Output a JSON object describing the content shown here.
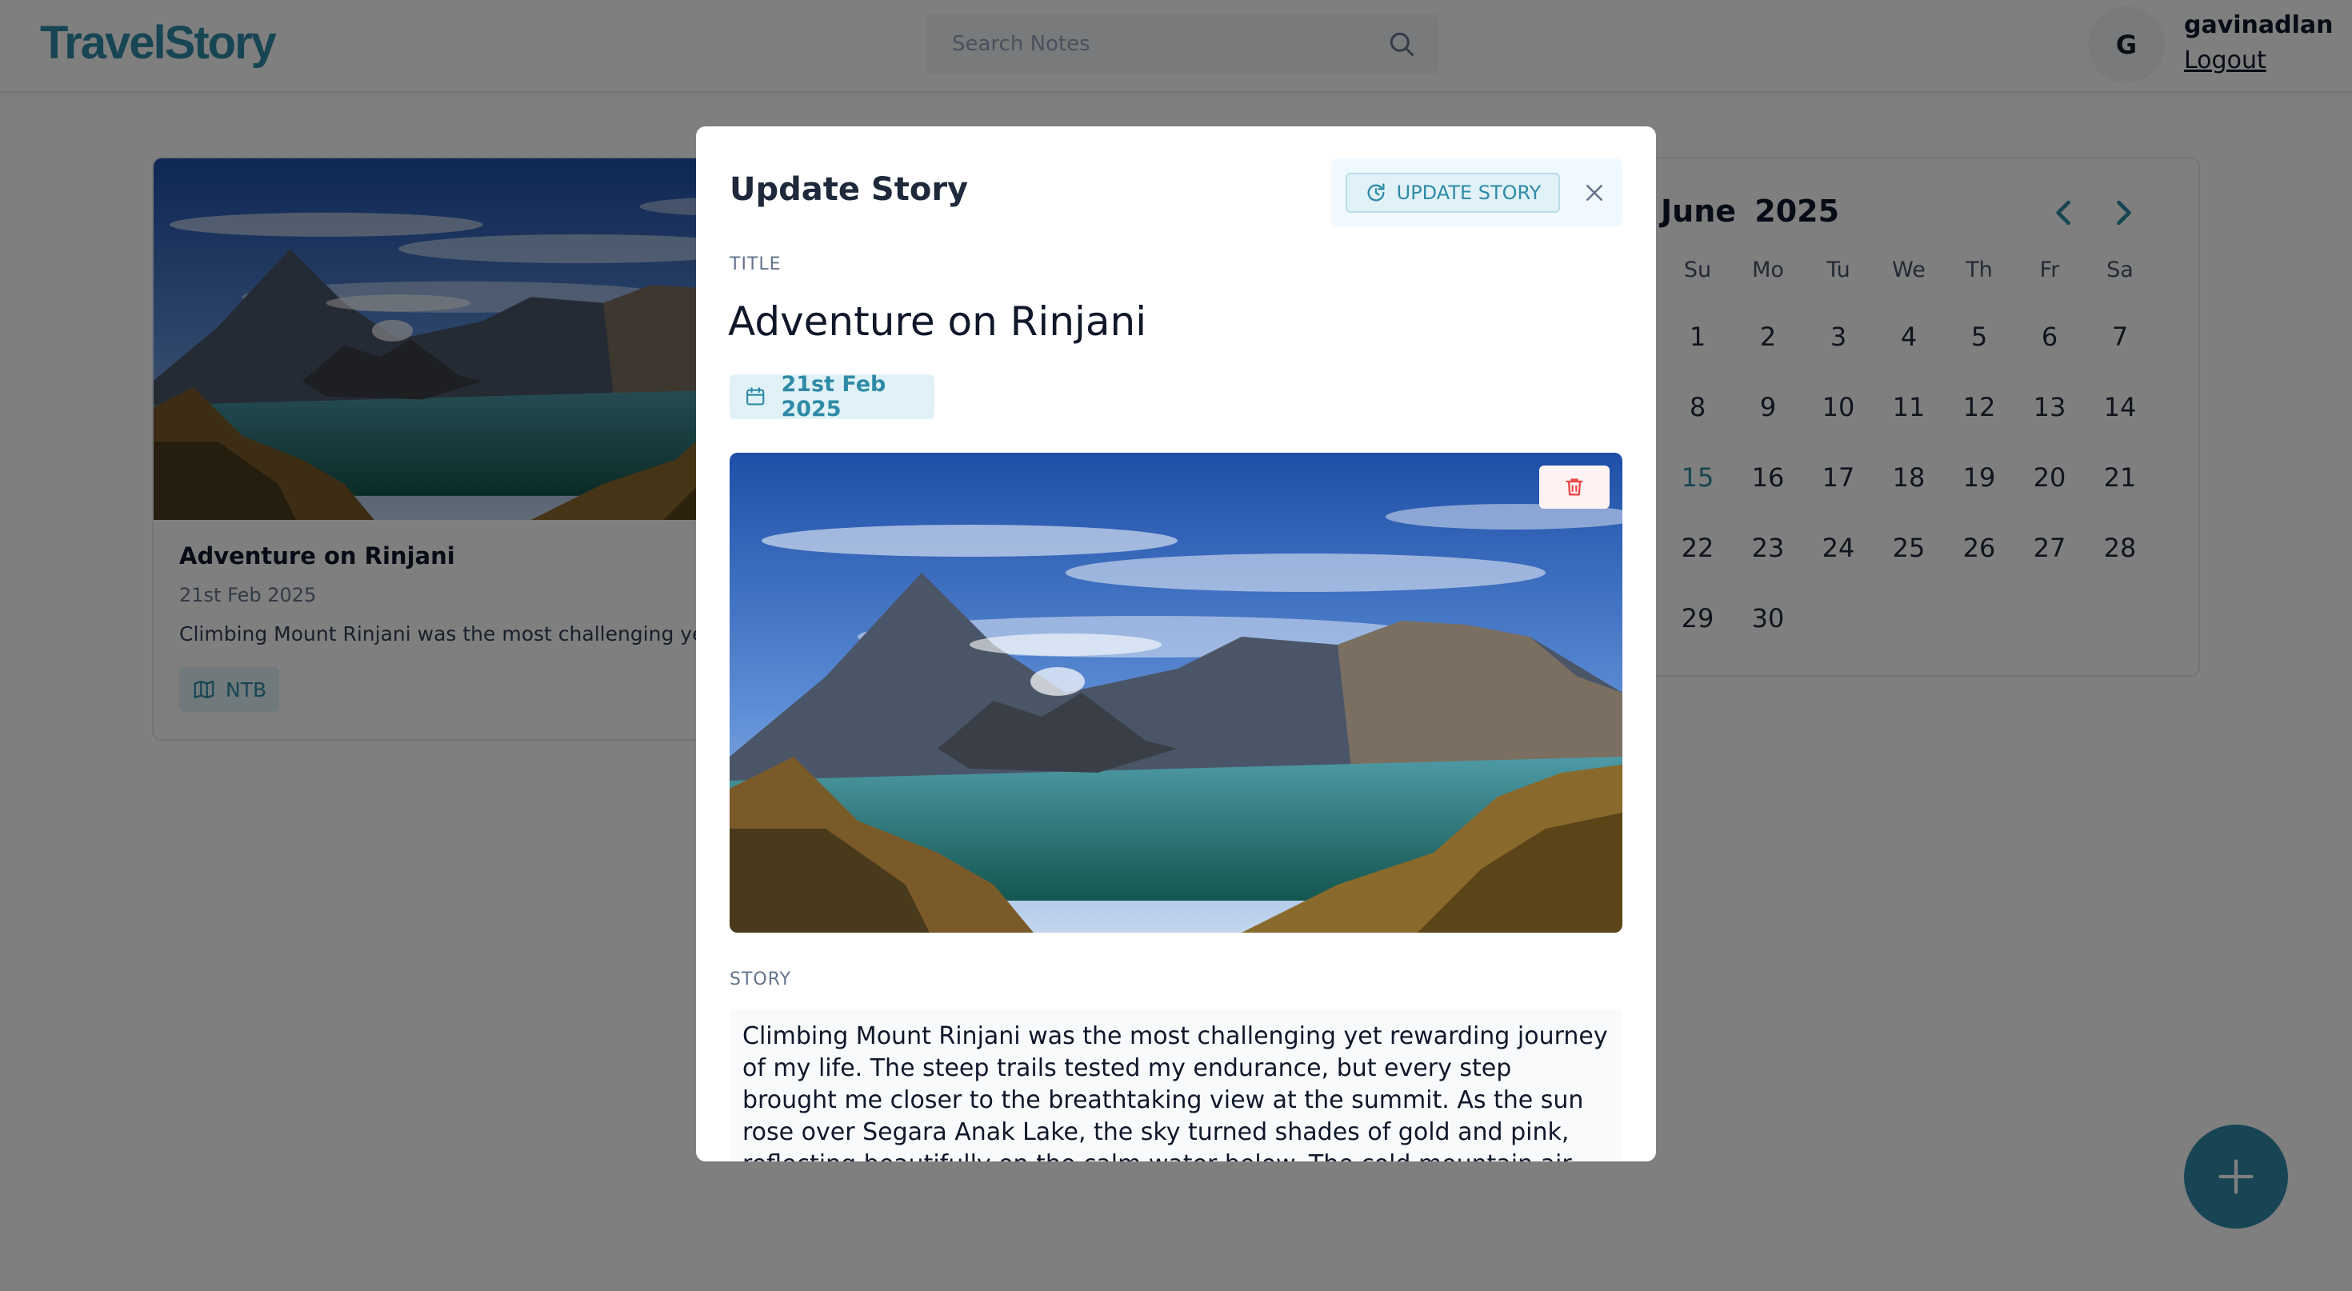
{
  "navbar": {
    "logo": "TravelStory",
    "search_placeholder": "Search Notes",
    "user_initial": "G",
    "user_name": "gavinadlan",
    "logout_label": "Logout"
  },
  "story_card": {
    "title": "Adventure on Rinjani",
    "date": "21st Feb 2025",
    "excerpt": "Climbing Mount Rinjani was the most challenging yet r",
    "location": "NTB"
  },
  "calendar": {
    "month": "June",
    "year": "2025",
    "weekdays": [
      "Su",
      "Mo",
      "Tu",
      "We",
      "Th",
      "Fr",
      "Sa"
    ],
    "days": [
      "1",
      "2",
      "3",
      "4",
      "5",
      "6",
      "7",
      "8",
      "9",
      "10",
      "11",
      "12",
      "13",
      "14",
      "15",
      "16",
      "17",
      "18",
      "19",
      "20",
      "21",
      "22",
      "23",
      "24",
      "25",
      "26",
      "27",
      "28",
      "29",
      "30"
    ],
    "today": "15"
  },
  "modal": {
    "heading": "Update Story",
    "update_label": "UPDATE STORY",
    "title_label": "TITLE",
    "title_value": "Adventure on Rinjani",
    "date": "21st Feb 2025",
    "story_label": "STORY",
    "story_text": "Climbing Mount Rinjani was the most challenging yet rewarding journey of my life. The steep trails tested my endurance, but every step brought me closer to the breathtaking view at the summit. As the sun rose over Segara Anak Lake, the sky turned shades of gold and pink, reflecting beautifully on the calm water below. The cold mountain air, the sound of the wind, and the"
  },
  "colors": {
    "brand": "#2f8aa6",
    "danger": "#ef4444",
    "overlay": "rgba(0,0,0,0.5)"
  },
  "icons": {
    "search": "search-icon",
    "calendar": "calendar-icon",
    "update": "refresh-icon",
    "close": "close-icon",
    "delete": "trash-icon",
    "location": "map-icon",
    "add": "plus-icon"
  }
}
